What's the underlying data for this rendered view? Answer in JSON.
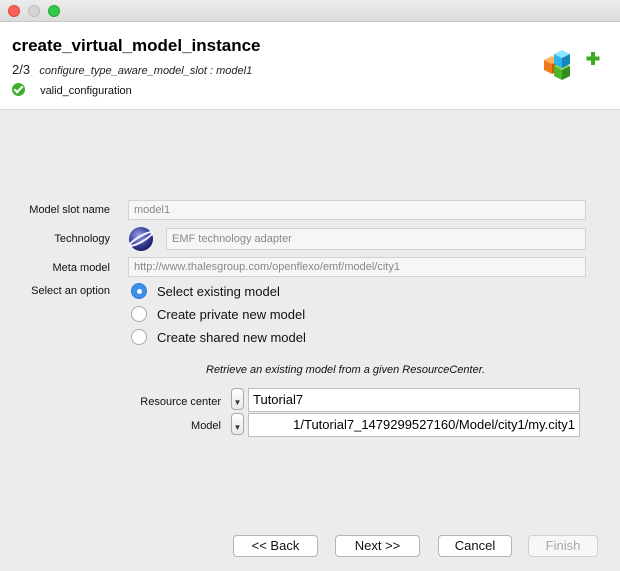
{
  "window": {
    "title": ""
  },
  "header": {
    "title": "create_virtual_model_instance",
    "step": "2/3",
    "step_description": "configure_type_aware_model_slot : model1",
    "status": "valid_configuration"
  },
  "form": {
    "model_slot_name": {
      "label": "Model slot name",
      "value": "model1"
    },
    "technology": {
      "label": "Technology",
      "value": "EMF technology adapter"
    },
    "meta_model": {
      "label": "Meta model",
      "value": "http://www.thalesgroup.com/openflexo/emf/model/city1"
    },
    "option": {
      "label": "Select an option",
      "choices": [
        {
          "label": "Select existing model",
          "selected": true
        },
        {
          "label": "Create private new model",
          "selected": false
        },
        {
          "label": "Create shared new model",
          "selected": false
        }
      ]
    },
    "hint": "Retrieve an existing model from a given ResourceCenter.",
    "resource_center": {
      "label": "Resource center",
      "value": "Tutorial7"
    },
    "model": {
      "label": "Model",
      "value": "1/Tutorial7_1479299527160/Model/city1/my.city1"
    }
  },
  "buttons": {
    "back": "<< Back",
    "next": "Next >>",
    "cancel": "Cancel",
    "finish": "Finish"
  },
  "icons": {
    "header": "cubes-add-icon",
    "technology": "eclipse-icon",
    "status": "check-icon"
  }
}
